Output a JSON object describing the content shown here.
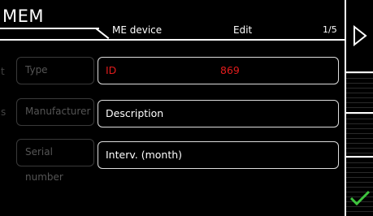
{
  "header": {
    "title": "MEM",
    "subtitle": "ME device",
    "mode": "Edit",
    "page": "1/5"
  },
  "background_buttons": [
    {
      "label": "Type",
      "edge": "t"
    },
    {
      "label": "Manufacturer",
      "edge": "s"
    },
    {
      "label": "Serial number",
      "edge": ""
    }
  ],
  "fields": [
    {
      "label": "ID",
      "value": "869",
      "color": "#e21c1c"
    },
    {
      "label": "Description",
      "value": "",
      "color": "#ffffff"
    },
    {
      "label": "Interv. (month)",
      "value": "",
      "color": "#ffffff"
    }
  ],
  "sidebar": {
    "next_icon": "play-right-icon",
    "confirm_icon": "checkmark-icon",
    "accent": "#3ec43e"
  }
}
